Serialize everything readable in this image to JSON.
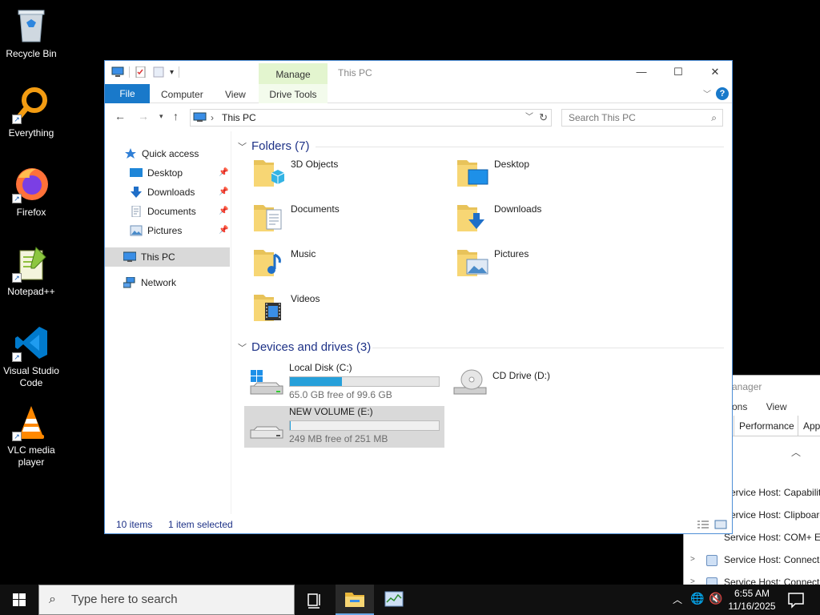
{
  "desktop": {
    "icons": [
      {
        "label": "Recycle Bin",
        "icon": "recycle-bin-icon"
      },
      {
        "label": "Everything",
        "icon": "everything-search-icon"
      },
      {
        "label": "Firefox",
        "icon": "firefox-icon"
      },
      {
        "label": "Notepad++",
        "icon": "notepad-plus-plus-icon"
      },
      {
        "label": "Visual Studio Code",
        "icon": "vscode-icon"
      },
      {
        "label": "VLC media player",
        "icon": "vlc-icon"
      }
    ]
  },
  "task_manager": {
    "title": "anager",
    "menu": [
      "ons",
      "View"
    ],
    "tabs": [
      "Performance",
      "App"
    ],
    "rows": [
      "Service Host: Capability",
      "Service Host: Clipboard",
      "Service Host: COM+ Ev",
      "Service Host: Connecte",
      "Service Host: Connecte"
    ]
  },
  "explorer": {
    "title": "This PC",
    "manage_tab": "Manage",
    "ribbon": {
      "file": "File",
      "computer": "Computer",
      "view": "View",
      "drive_tools": "Drive Tools",
      "help": "?"
    },
    "address": "This PC",
    "search_placeholder": "Search This PC",
    "nav": {
      "quick_access": "Quick access",
      "desktop": "Desktop",
      "downloads": "Downloads",
      "documents": "Documents",
      "pictures": "Pictures",
      "this_pc": "This PC",
      "network": "Network"
    },
    "folders_header": "Folders (7)",
    "folders": [
      {
        "name": "3D Objects",
        "icon": "3d-objects-folder-icon"
      },
      {
        "name": "Desktop",
        "icon": "desktop-folder-icon"
      },
      {
        "name": "Documents",
        "icon": "documents-folder-icon"
      },
      {
        "name": "Downloads",
        "icon": "downloads-folder-icon"
      },
      {
        "name": "Music",
        "icon": "music-folder-icon"
      },
      {
        "name": "Pictures",
        "icon": "pictures-folder-icon"
      },
      {
        "name": "Videos",
        "icon": "videos-folder-icon"
      }
    ],
    "devices_header": "Devices and drives (3)",
    "drives": [
      {
        "name": "Local Disk (C:)",
        "free": "65.0 GB free of 99.6 GB",
        "used_fraction": 0.347
      },
      {
        "name": "CD Drive (D:)"
      },
      {
        "name": "NEW VOLUME (E:)",
        "free": "249 MB free of 251 MB",
        "used_fraction": 0.008
      }
    ],
    "status": {
      "items": "10 items",
      "selected": "1 item selected"
    }
  },
  "taskbar": {
    "search_placeholder": "Type here to search",
    "time": "6:55 AM",
    "date": "11/16/2025"
  },
  "colors": {
    "accent": "#1979ca",
    "manage_tab": "#e3f5cf",
    "drive_bar": "#26a0da",
    "selection": "#d9d9d9",
    "group_header": "#1e3287"
  }
}
